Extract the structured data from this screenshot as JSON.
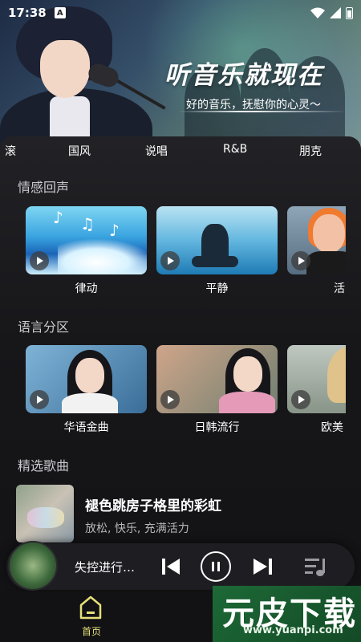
{
  "status_bar": {
    "time": "17:38",
    "notification": "A"
  },
  "banner": {
    "title": "听音乐就现在",
    "subtitle": "好的音乐，抚慰你的心灵～"
  },
  "genre_tabs": [
    "滚",
    "国风",
    "说唱",
    "R&B",
    "朋克"
  ],
  "sections": {
    "emotion": {
      "title": "情感回声",
      "cards": [
        {
          "label": "律动"
        },
        {
          "label": "平静"
        },
        {
          "label": "活"
        }
      ]
    },
    "language": {
      "title": "语言分区",
      "cards": [
        {
          "label": "华语金曲"
        },
        {
          "label": "日韩流行"
        },
        {
          "label": "欧美"
        }
      ]
    },
    "featured": {
      "title": "精选歌曲",
      "song": {
        "title": "褪色跳房子格里的彩虹",
        "tags": "放松, 快乐, 充满活力"
      }
    }
  },
  "player": {
    "title": "失控进行…",
    "state": "playing"
  },
  "bottom_nav": {
    "home_label": "首页"
  },
  "watermark": {
    "text": "元皮下载",
    "url": "www.yuanpi.com"
  },
  "colors": {
    "accent": "#e6e07a",
    "background": "#111114"
  }
}
